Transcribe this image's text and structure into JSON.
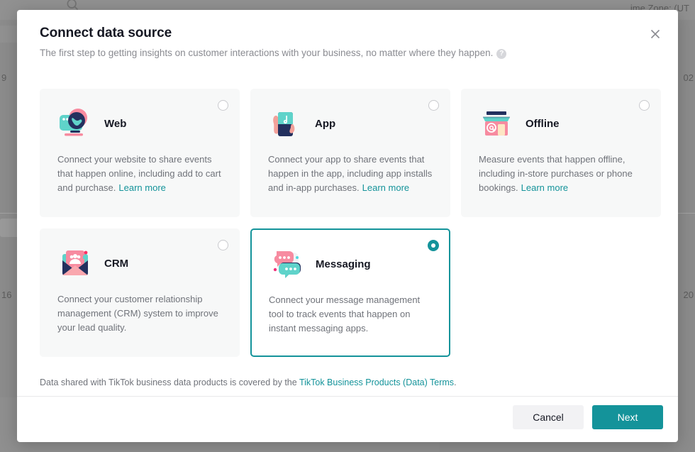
{
  "background": {
    "timezone_text": "ime Zone: (UT",
    "left_value_top": "9",
    "left_value_bottom": "16",
    "right_value_top": "02",
    "right_value_bottom": "20",
    "search_icon": "search-icon"
  },
  "dialog": {
    "title": "Connect data source",
    "subtitle": "The first step to getting insights on customer interactions with your business, no matter where they happen.",
    "help_tooltip": "?",
    "close_label": "✕"
  },
  "accent_color": "#14939a",
  "cards": [
    {
      "id": "web",
      "title": "Web",
      "icon": "web-browser-globe-icon",
      "description": "Connect your website to share events that happen online, including add to cart and purchase.",
      "learn_more": "Learn more",
      "selected": false
    },
    {
      "id": "app",
      "title": "App",
      "icon": "mobile-phone-hand-icon",
      "description": "Connect your app to share events that happen in the app, including app installs and in-app purchases.",
      "learn_more": "Learn more",
      "selected": false
    },
    {
      "id": "offline",
      "title": "Offline",
      "icon": "storefront-icon",
      "description": "Measure events that happen offline, including in-store purchases or phone bookings.",
      "learn_more": "Learn more",
      "selected": false
    },
    {
      "id": "crm",
      "title": "CRM",
      "icon": "envelope-contacts-icon",
      "description": "Connect your customer relationship management (CRM) system to improve your lead quality.",
      "learn_more": "",
      "selected": false
    },
    {
      "id": "messaging",
      "title": "Messaging",
      "icon": "chat-bubbles-icon",
      "description": "Connect your message management tool to track events that happen on instant messaging apps.",
      "learn_more": "",
      "selected": true
    }
  ],
  "legal": {
    "prefix": "Data shared with TikTok business data products is covered by the ",
    "link_text": "TikTok Business Products (Data) Terms",
    "suffix": "."
  },
  "footer": {
    "cancel_label": "Cancel",
    "next_label": "Next"
  }
}
